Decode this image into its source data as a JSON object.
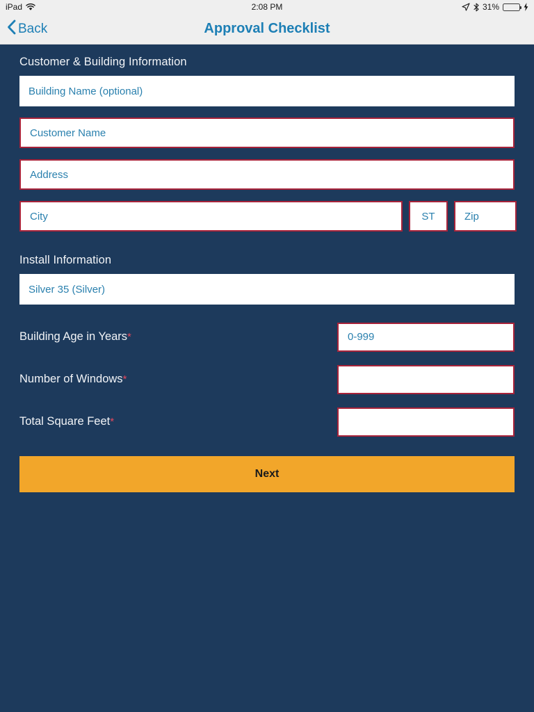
{
  "status_bar": {
    "device": "iPad",
    "wifi_icon": "wifi-icon",
    "time": "2:08 PM",
    "location_icon": "location-arrow-icon",
    "bluetooth_icon": "bluetooth-icon",
    "battery_percent": "31%",
    "battery_level": 31,
    "charging_icon": "lightning-bolt-icon"
  },
  "nav_bar": {
    "back_label": "Back",
    "back_icon": "chevron-left-icon",
    "title": "Approval Checklist"
  },
  "colors": {
    "background": "#1d3a5c",
    "accent_blue": "#1d7fb5",
    "placeholder_blue": "#2a80ae",
    "required_border": "#a8233a",
    "required_star": "#e5485c",
    "button_orange": "#f2a62a",
    "bar_gray": "#efefef"
  },
  "sections": {
    "customer_building": {
      "heading": "Customer & Building Information",
      "fields": {
        "building_name": {
          "placeholder": "Building Name (optional)",
          "value": "",
          "required": false
        },
        "customer_name": {
          "placeholder": "Customer Name",
          "value": "",
          "required": true
        },
        "address": {
          "placeholder": "Address",
          "value": "",
          "required": true
        },
        "city": {
          "placeholder": "City",
          "value": "",
          "required": true
        },
        "state": {
          "placeholder": "ST",
          "value": "",
          "required": true
        },
        "zip": {
          "placeholder": "Zip",
          "value": "",
          "required": true
        }
      }
    },
    "install_information": {
      "heading": "Install Information",
      "product_select": {
        "selected": "Silver 35 (Silver)",
        "required": false
      },
      "rows": [
        {
          "label": "Building Age in Years",
          "required_marker": "*",
          "placeholder": "0-999",
          "value": ""
        },
        {
          "label": "Number of Windows",
          "required_marker": "*",
          "placeholder": "",
          "value": ""
        },
        {
          "label": "Total Square Feet",
          "required_marker": "*",
          "placeholder": "",
          "value": ""
        }
      ]
    }
  },
  "footer": {
    "next_label": "Next"
  }
}
